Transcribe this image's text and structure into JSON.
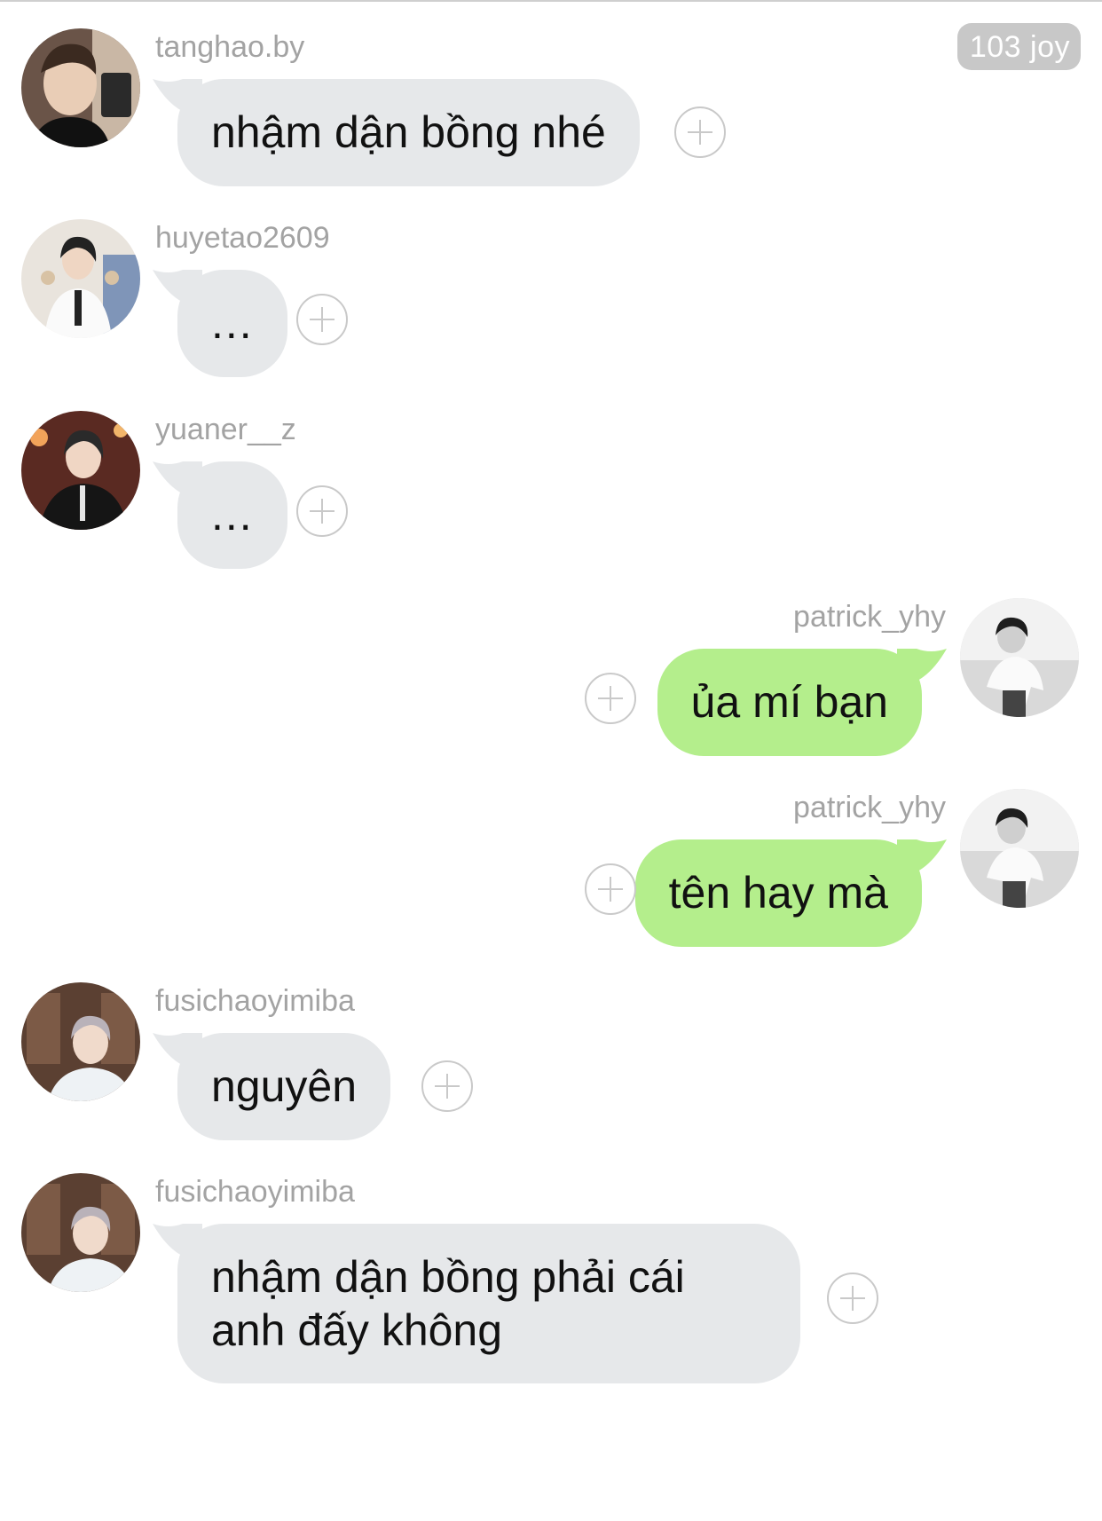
{
  "header": {
    "badge": "103 joy"
  },
  "messages": [
    {
      "user": "tanghao.by",
      "text": "nhậm dận bồng nhé",
      "side": "left"
    },
    {
      "user": "huyetao2609",
      "text": "...",
      "side": "left"
    },
    {
      "user": "yuaner__z",
      "text": "...",
      "side": "left"
    },
    {
      "user": "patrick_yhy",
      "text": "ủa mí bạn",
      "side": "right"
    },
    {
      "user": "patrick_yhy",
      "text": "tên hay mà",
      "side": "right"
    },
    {
      "user": "fusichaoyimiba",
      "text": "nguyên",
      "side": "left"
    },
    {
      "user": "fusichaoyimiba",
      "text": "nhậm dận bồng phải cái anh đấy không",
      "side": "left"
    }
  ],
  "colors": {
    "incoming_bubble": "#e6e8ea",
    "outgoing_bubble": "#b4ee8c",
    "username": "#a3a3a3",
    "badge_bg": "#c8c8c8"
  },
  "icons": {
    "add_reaction": "plus-circle-icon"
  }
}
